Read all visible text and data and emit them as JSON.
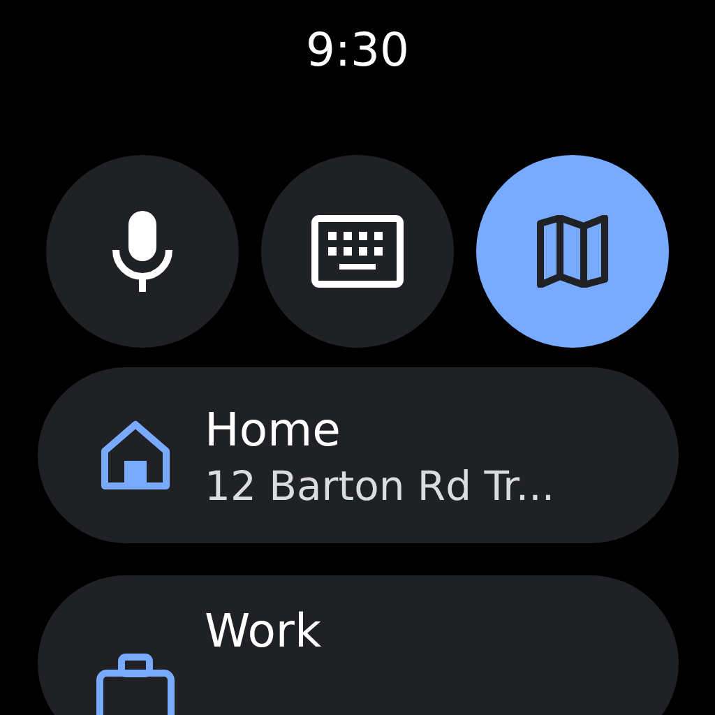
{
  "status_bar": {
    "time": "9:30"
  },
  "input_buttons": [
    {
      "kind": "voice",
      "selected": false
    },
    {
      "kind": "keyboard",
      "selected": false
    },
    {
      "kind": "map",
      "selected": true
    }
  ],
  "places": [
    {
      "kind": "home",
      "title": "Home",
      "subtitle": "12 Barton Rd Tr..."
    },
    {
      "kind": "work",
      "title": "Work"
    }
  ]
}
